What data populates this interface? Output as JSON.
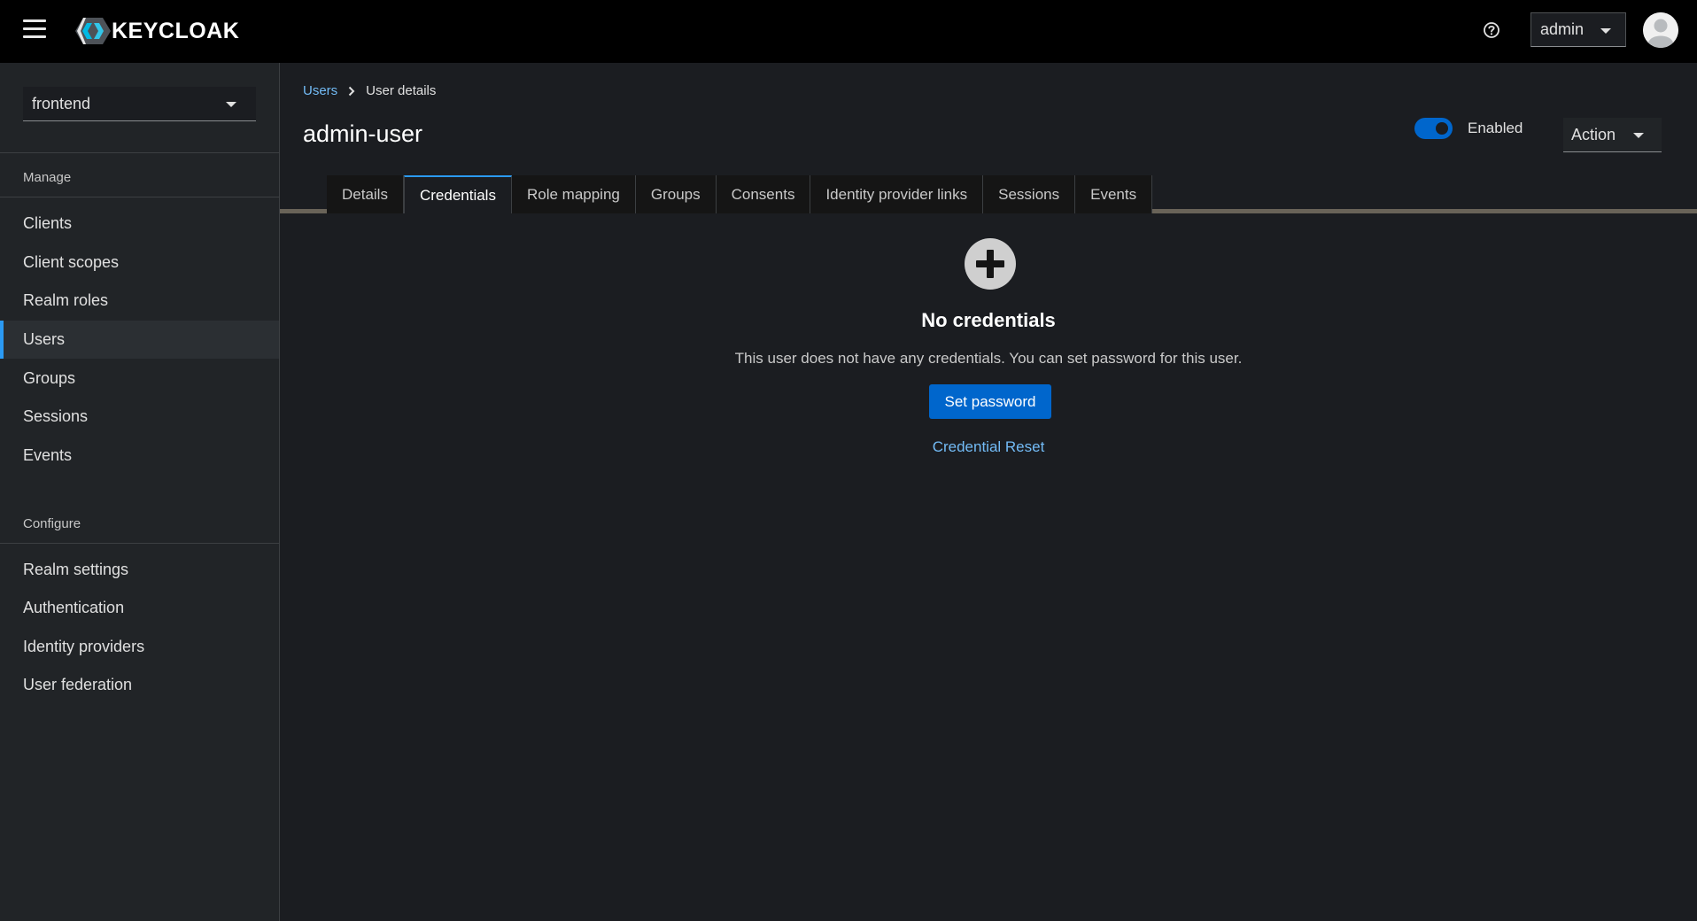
{
  "masthead": {
    "logo_text": "KEYCLOAK",
    "user_menu_label": "admin",
    "icons": {
      "menu": "hamburger-icon",
      "help": "help-icon",
      "avatar": "user-avatar-icon"
    }
  },
  "sidebar": {
    "realm": "frontend",
    "sections": [
      {
        "title": "Manage",
        "items": [
          "Clients",
          "Client scopes",
          "Realm roles",
          "Users",
          "Groups",
          "Sessions",
          "Events"
        ]
      },
      {
        "title": "Configure",
        "items": [
          "Realm settings",
          "Authentication",
          "Identity providers",
          "User federation"
        ]
      }
    ],
    "active_item": "Users"
  },
  "breadcrumb": {
    "parent": "Users",
    "current": "User details"
  },
  "page": {
    "title": "admin-user",
    "enabled_label": "Enabled",
    "enabled": true,
    "action_label": "Action"
  },
  "tabs": [
    "Details",
    "Credentials",
    "Role mapping",
    "Groups",
    "Consents",
    "Identity provider links",
    "Sessions",
    "Events"
  ],
  "active_tab": "Credentials",
  "empty_state": {
    "icon": "plus-circle-icon",
    "title": "No credentials",
    "body": "This user does not have any credentials. You can set password for this user.",
    "primary_action": "Set password",
    "secondary_action": "Credential Reset"
  },
  "colors": {
    "accent": "#0066cc",
    "link": "#73bcf7",
    "active_border": "#2b9af3"
  }
}
